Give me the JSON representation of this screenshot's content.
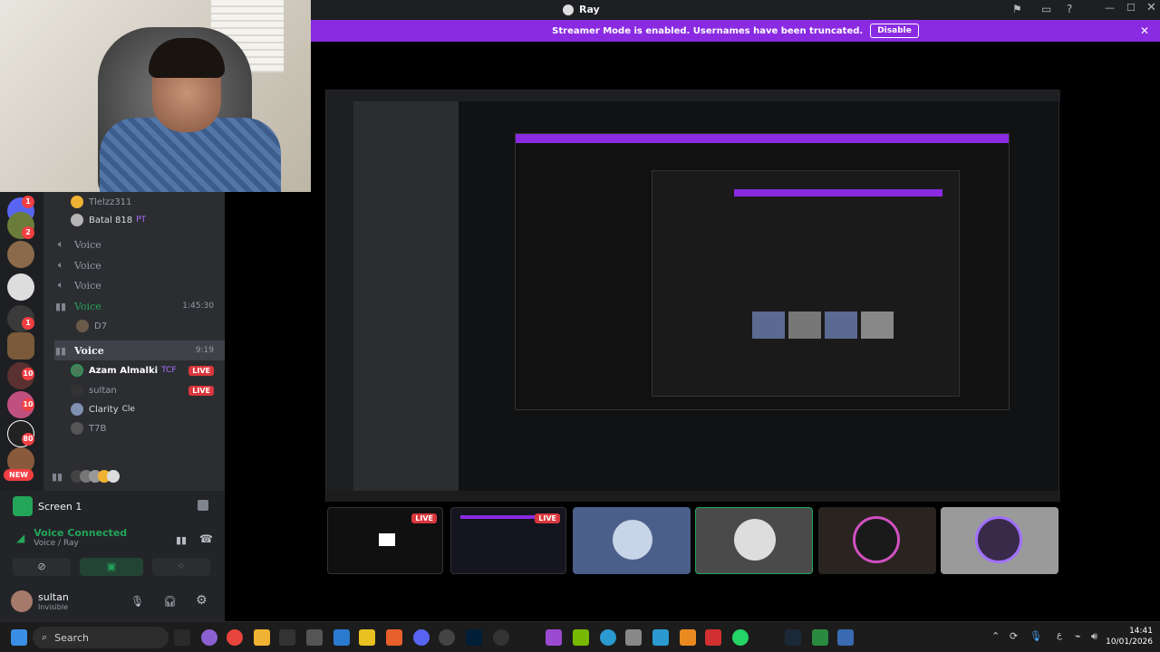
{
  "window": {
    "title": "Ray",
    "streamer_banner": "Streamer Mode is enabled. Usernames have been truncated.",
    "disable_label": "Disable",
    "accent": "#8a2be2"
  },
  "server_rail": {
    "new_label": "NEW",
    "badges": [
      "1",
      "2",
      "1",
      "10",
      "10",
      "80"
    ]
  },
  "channels": {
    "top_users": [
      {
        "name": "Tlelzz311"
      },
      {
        "name": "Batal 818",
        "tag": "PT"
      }
    ],
    "voice_label": "Voice",
    "voice_channels": [
      {
        "name": "Voice"
      },
      {
        "name": "Voice"
      },
      {
        "name": "Voice"
      }
    ],
    "active_voice_1": {
      "name": "Voice",
      "time": "1:45:30",
      "users": [
        "D7"
      ]
    },
    "active_voice_2": {
      "name": "Voice",
      "time": "9:19",
      "users": [
        {
          "name": "Azam Almalki",
          "tag": "TCF",
          "live": "LIVE"
        },
        {
          "name": "sultan",
          "live": "LIVE"
        },
        {
          "name": "Clarity",
          "tag": "Cle"
        },
        {
          "name": "T7B"
        }
      ]
    }
  },
  "bottom": {
    "screen_title": "Screen 1",
    "voice_connected": "Voice Connected",
    "voice_sub": "Voice / Ray",
    "user_name": "sultan",
    "user_status": "Invisible"
  },
  "taskbar": {
    "search_placeholder": "Search",
    "time": "14:41",
    "date": "10/01/2026",
    "lang": "ع"
  },
  "stream": {
    "live_label": "LIVE"
  }
}
